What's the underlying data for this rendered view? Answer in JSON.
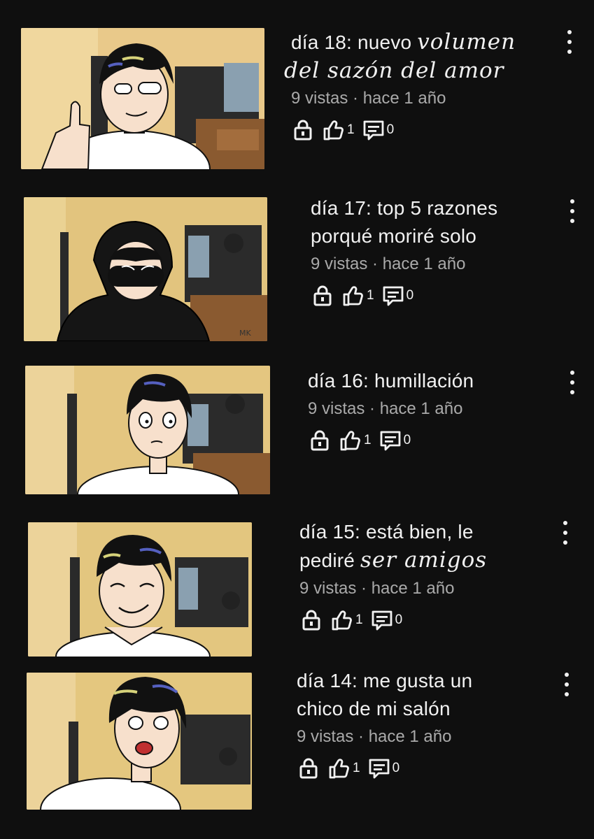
{
  "videos": [
    {
      "title_a": "día 18: nuevo ",
      "title_b": "volumen",
      "title_line2": "del sazón del amor",
      "views": "9 vistas",
      "sep": " · ",
      "age": "hace 1 año",
      "likes": "1",
      "comments": "0",
      "visibility_icon": "lock-icon"
    },
    {
      "title_a": "día 17: top 5 razones",
      "title_line2": "porqué moriré solo",
      "views": "9 vistas",
      "sep": " · ",
      "age": "hace 1 año",
      "likes": "1",
      "comments": "0"
    },
    {
      "title_a": "día 16: humillación",
      "views": "9 vistas",
      "sep": " · ",
      "age": "hace 1 año",
      "likes": "1",
      "comments": "0"
    },
    {
      "title_a": "día 15: está bien, le",
      "title_line2_a": "pediré ",
      "title_line2_b": "ser amigos",
      "views": "9 vistas",
      "sep": " · ",
      "age": "hace 1 año",
      "likes": "1",
      "comments": "0"
    },
    {
      "title_a": "día 14: me gusta un",
      "title_line2": "chico de mi salón",
      "views": "9 vistas",
      "sep": " · ",
      "age": "hace 1 año",
      "likes": "1",
      "comments": "0"
    }
  ],
  "icons": {
    "lock": "lock-icon",
    "like": "thumbs-up-icon",
    "comment": "comment-icon",
    "menu": "more-vert-icon"
  },
  "colors": {
    "background": "#0f0f0f",
    "text": "#f1f1f1",
    "secondary": "#aaaaaa"
  },
  "thumbnail_marks": [
    "MK"
  ]
}
